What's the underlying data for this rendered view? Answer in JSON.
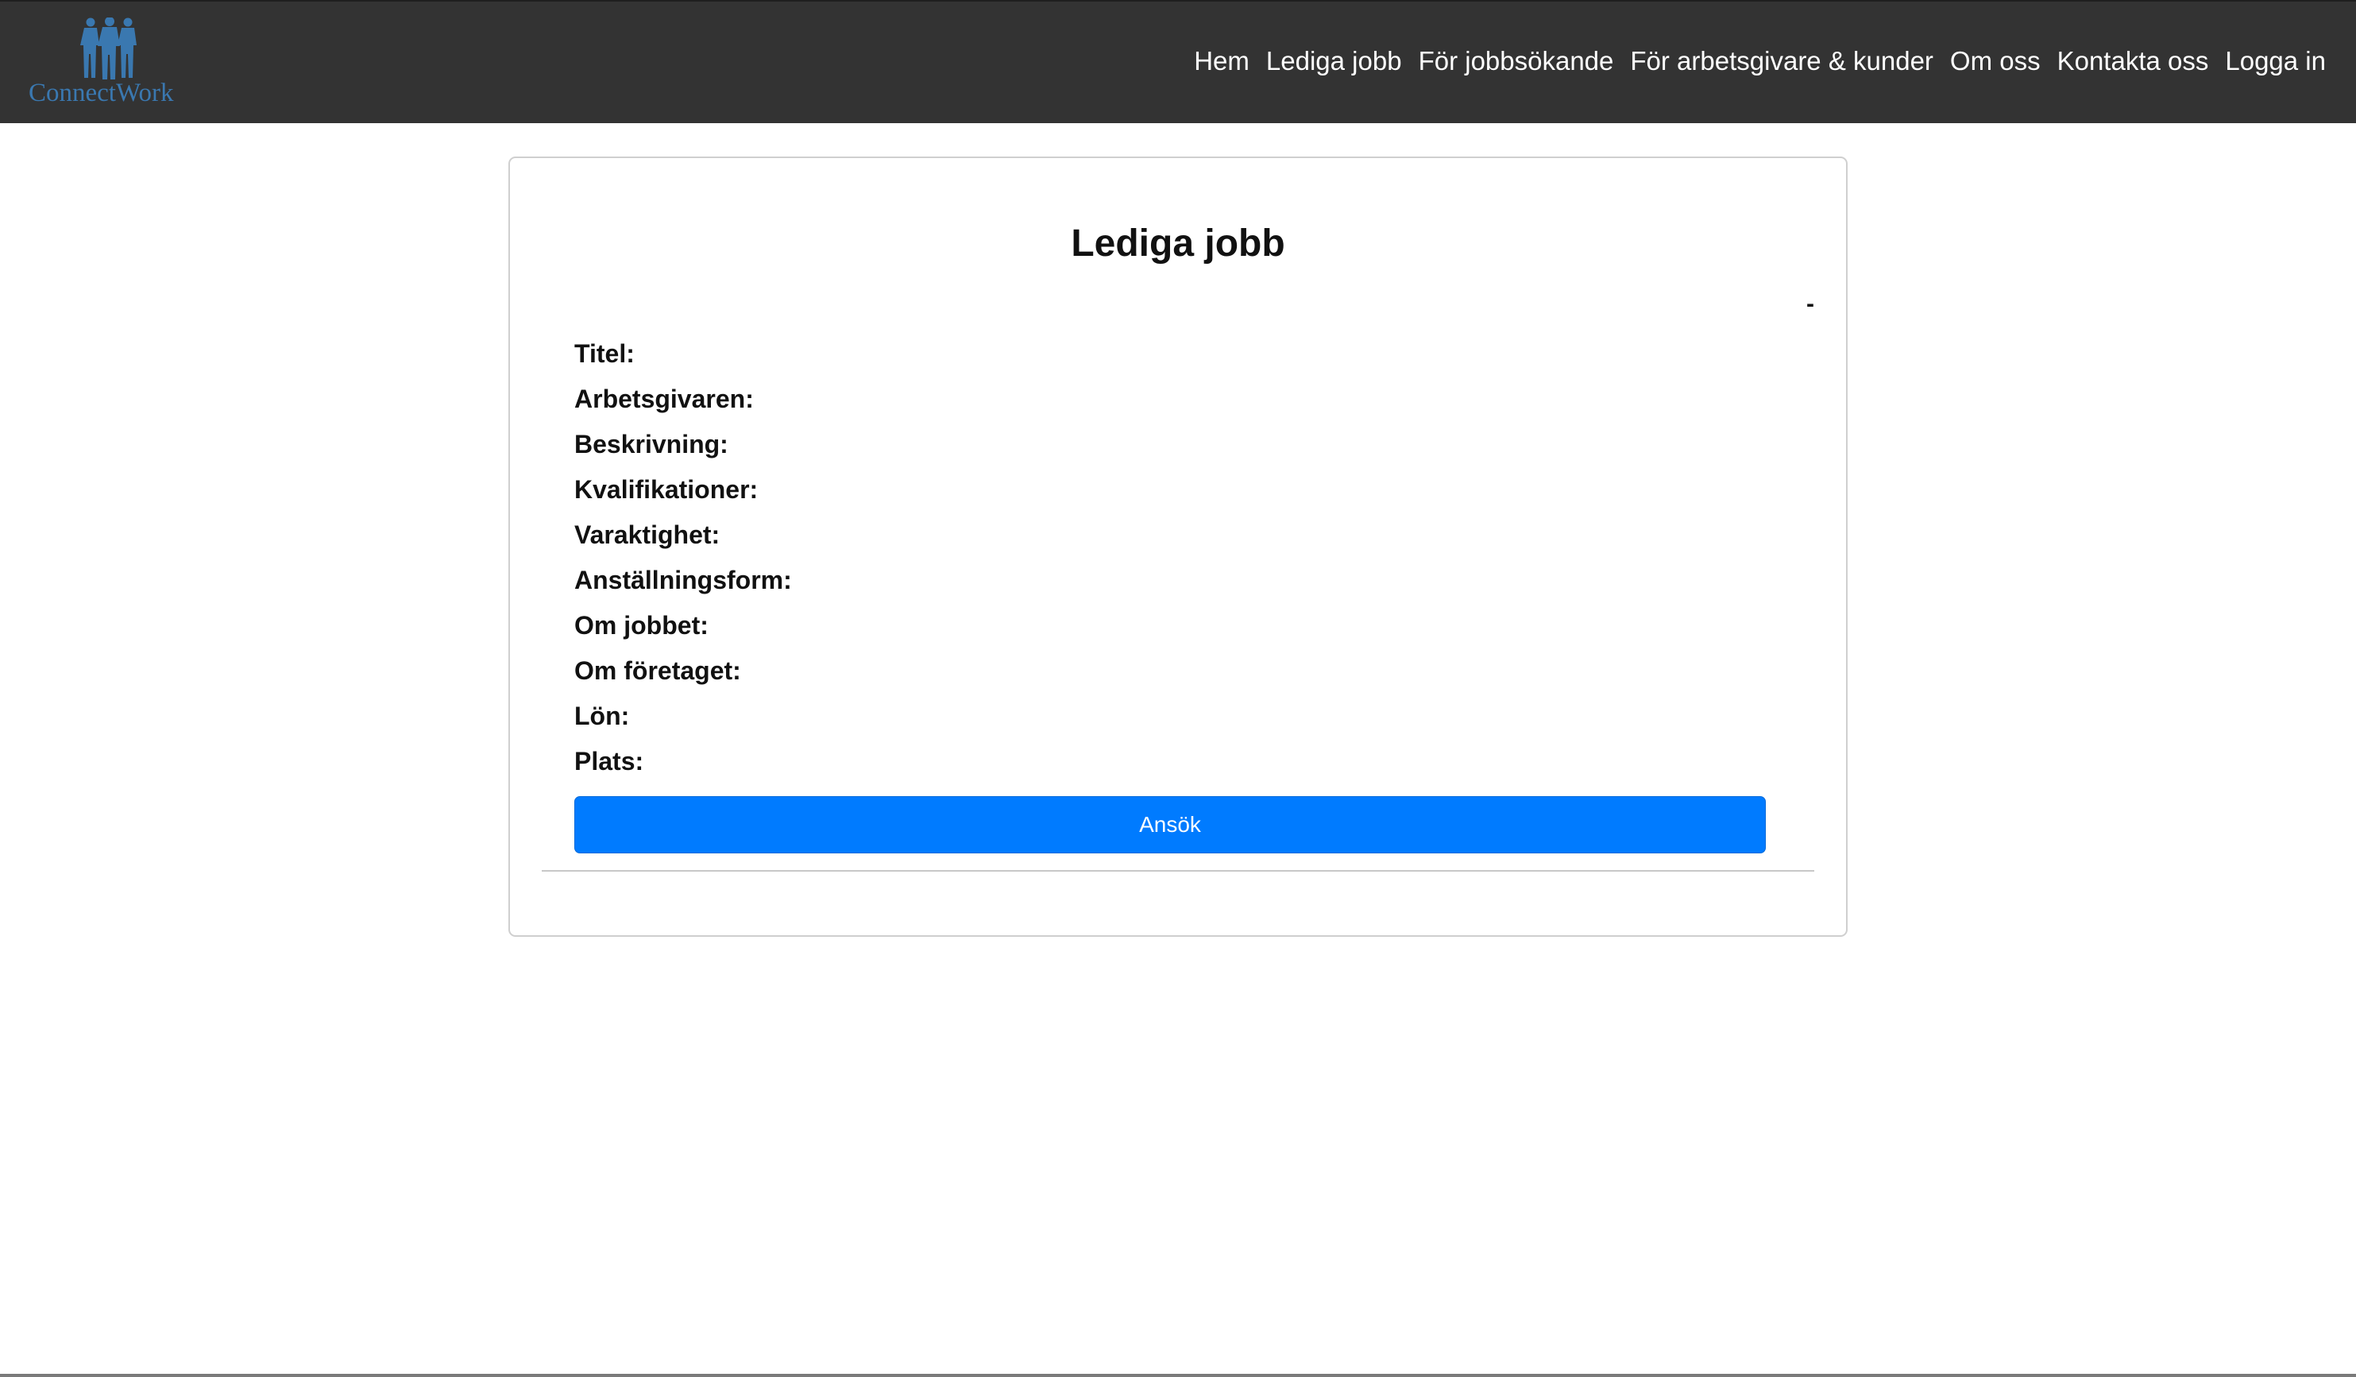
{
  "brand": {
    "name": "ConnectWork",
    "icon": "people-logo-icon",
    "color": "#3a78b0"
  },
  "nav": {
    "items": [
      {
        "label": "Hem"
      },
      {
        "label": "Lediga jobb"
      },
      {
        "label": "För jobbsökande"
      },
      {
        "label": "För arbetsgivare & kunder"
      },
      {
        "label": "Om oss"
      },
      {
        "label": "Kontakta oss"
      },
      {
        "label": "Logga in"
      }
    ]
  },
  "job": {
    "title": "Lediga jobb",
    "dash": "-",
    "fields": [
      {
        "label": "Titel:"
      },
      {
        "label": "Arbetsgivaren:"
      },
      {
        "label": "Beskrivning:"
      },
      {
        "label": "Kvalifikationer:"
      },
      {
        "label": "Varaktighet:"
      },
      {
        "label": "Anställningsform:"
      },
      {
        "label": "Om jobbet:"
      },
      {
        "label": "Om företaget:"
      },
      {
        "label": "Lön:"
      },
      {
        "label": "Plats:"
      }
    ],
    "apply_label": "Ansök",
    "apply_color": "#007bff"
  }
}
